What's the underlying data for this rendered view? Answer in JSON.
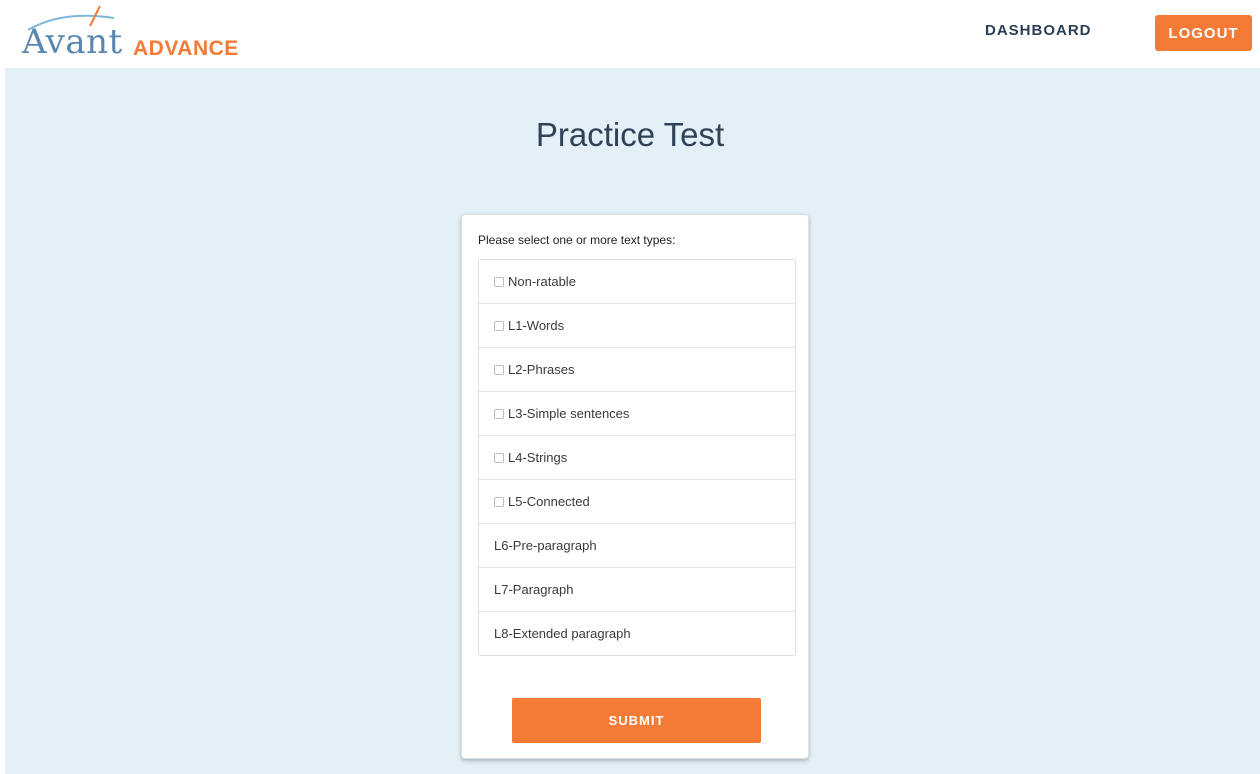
{
  "header": {
    "logo": {
      "brand": "Avant",
      "product": "ADVANCE"
    },
    "nav": {
      "dashboard_label": "DASHBOARD",
      "logout_label": "LOGOUT"
    }
  },
  "main": {
    "title": "Practice Test",
    "form": {
      "prompt": "Please select one or more text types:",
      "options": [
        {
          "label": "Non-ratable",
          "has_checkbox": true,
          "checked": false
        },
        {
          "label": "L1-Words",
          "has_checkbox": true,
          "checked": false
        },
        {
          "label": "L2-Phrases",
          "has_checkbox": true,
          "checked": false
        },
        {
          "label": "L3-Simple sentences",
          "has_checkbox": true,
          "checked": false
        },
        {
          "label": "L4-Strings",
          "has_checkbox": true,
          "checked": false
        },
        {
          "label": "L5-Connected",
          "has_checkbox": true,
          "checked": false
        },
        {
          "label": "L6-Pre-paragraph",
          "has_checkbox": false,
          "checked": false
        },
        {
          "label": "L7-Paragraph",
          "has_checkbox": false,
          "checked": false
        },
        {
          "label": "L8-Extended paragraph",
          "has_checkbox": false,
          "checked": false
        }
      ],
      "submit_label": "SUBMIT"
    }
  },
  "colors": {
    "accent": "#f47b35",
    "logo_blue": "#5a87b1",
    "nav_text": "#2a3f55",
    "background": "#e3f0f7"
  }
}
